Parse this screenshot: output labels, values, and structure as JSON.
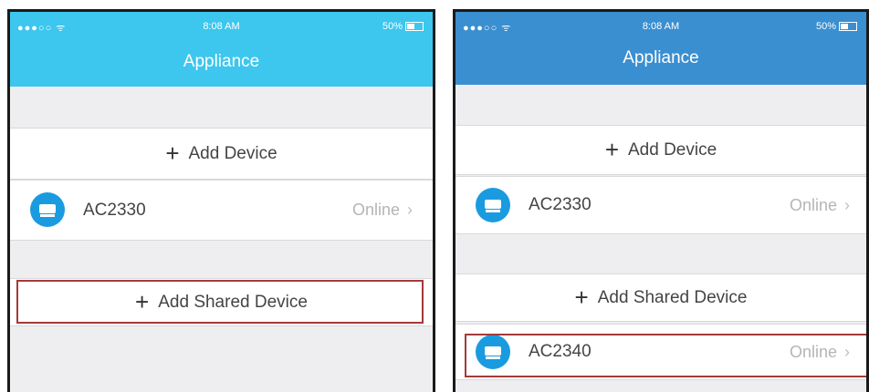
{
  "status_bar": {
    "signal": "●●●○○ ᯤ",
    "time": "8:08 AM",
    "battery": "50%"
  },
  "header": {
    "title": "Appliance"
  },
  "left": {
    "add_device": "Add Device",
    "device": {
      "name": "AC2330",
      "status": "Online"
    },
    "add_shared": "Add Shared Device"
  },
  "right": {
    "add_device": "Add Device",
    "device1": {
      "name": "AC2330",
      "status": "Online"
    },
    "add_shared": "Add Shared Device",
    "device2": {
      "name": "AC2340",
      "status": "Online"
    }
  },
  "colors": {
    "header_left": "#3dc6ee",
    "header_right": "#3a8fd0",
    "device_icon": "#1a9be0",
    "highlight": "#a33a3a"
  },
  "icons": {
    "plus": "+",
    "chevron": "›"
  }
}
